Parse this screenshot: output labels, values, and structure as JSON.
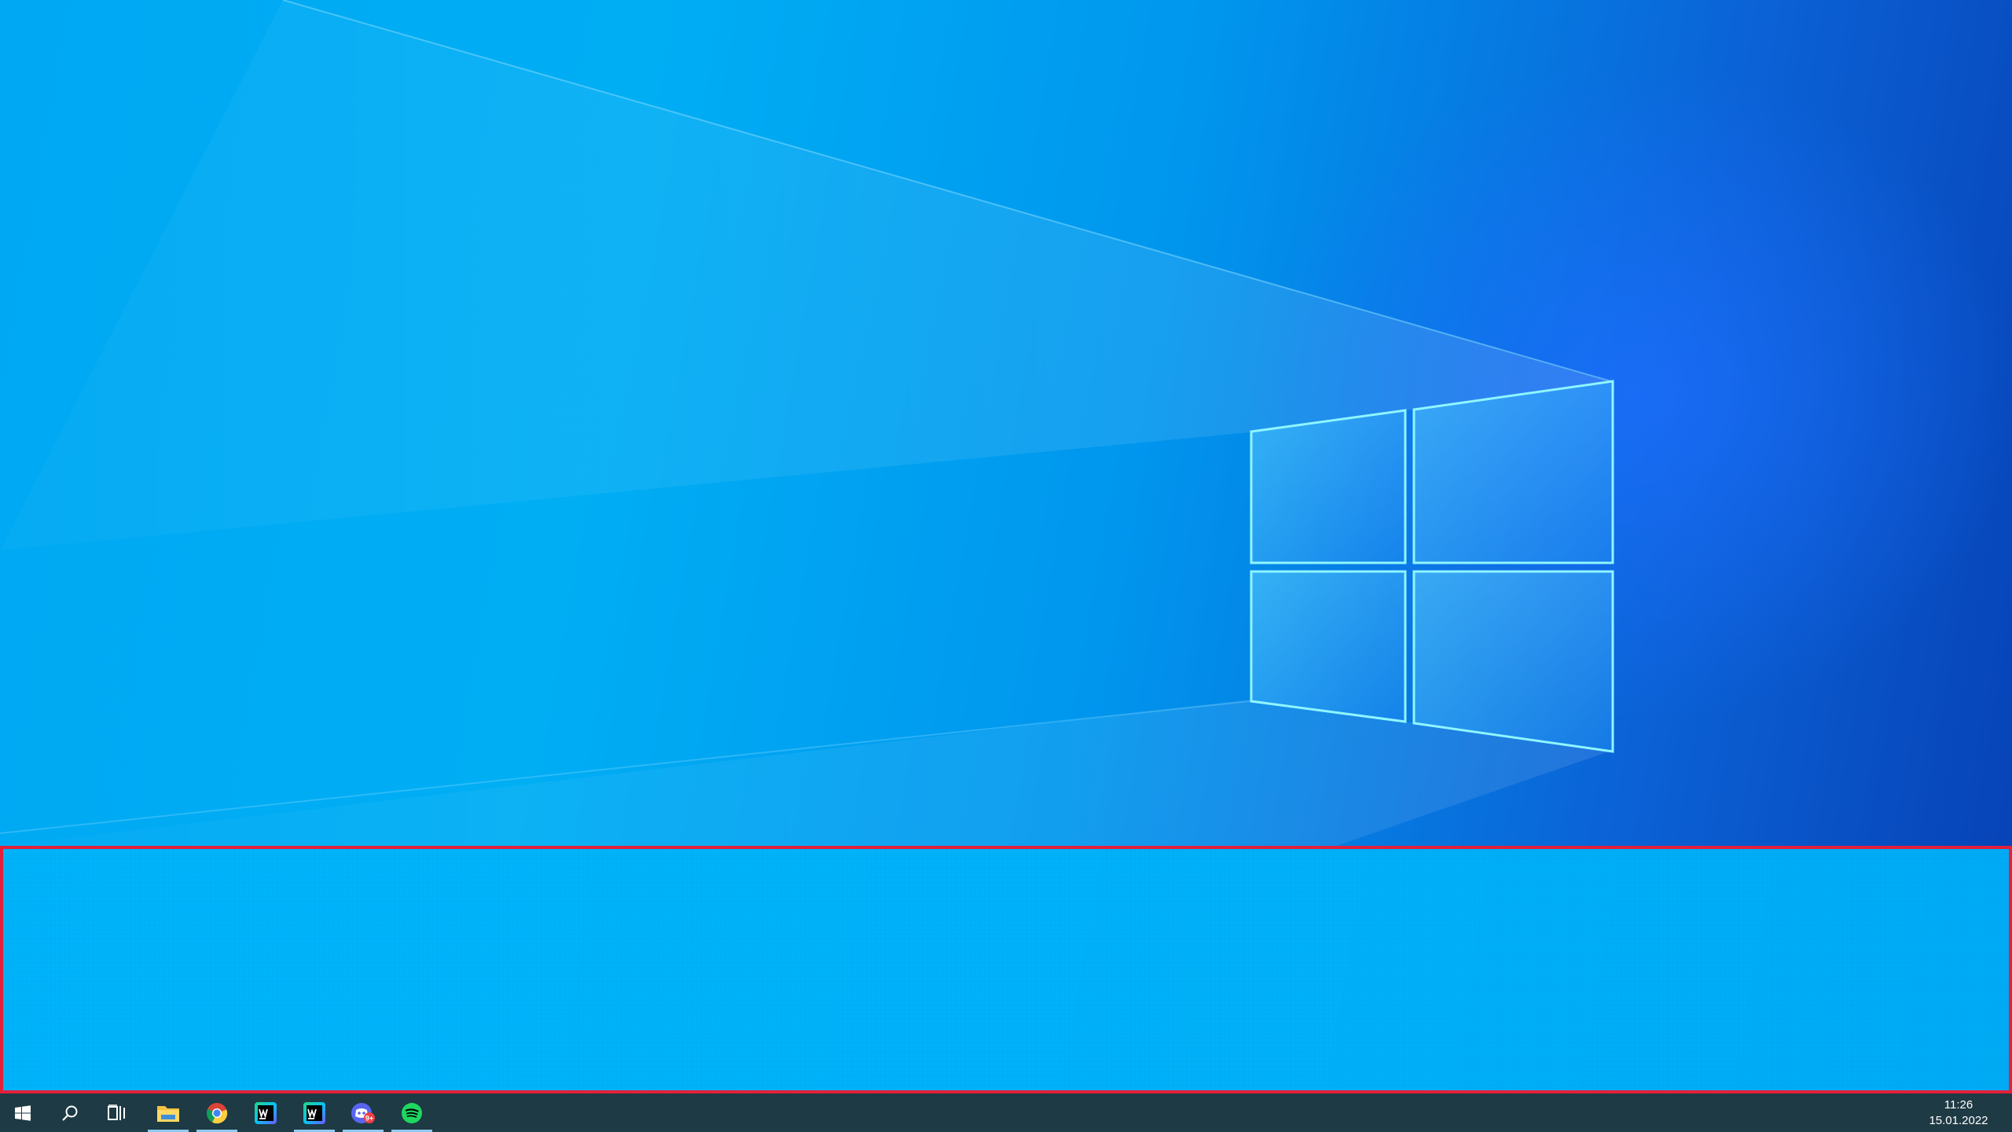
{
  "desktop": {
    "wallpaper": "windows-10-hero",
    "colors": {
      "light_blue": "#00aef4",
      "deep_blue": "#0640b4",
      "logo_glow": "#7ff3ff"
    }
  },
  "selection": {
    "border_color": "#e3203a"
  },
  "taskbar": {
    "background": "#1e3a44",
    "system_buttons": [
      {
        "name": "start-button",
        "icon": "windows-logo-icon"
      },
      {
        "name": "search-button",
        "icon": "search-icon"
      },
      {
        "name": "task-view-button",
        "icon": "task-view-icon"
      }
    ],
    "apps": [
      {
        "name": "file-explorer",
        "icon": "folder-icon",
        "running": true
      },
      {
        "name": "google-chrome",
        "icon": "chrome-icon",
        "running": true
      },
      {
        "name": "webstorm",
        "icon": "webstorm-icon",
        "running": false
      },
      {
        "name": "webstorm-2",
        "icon": "webstorm-icon",
        "running": true
      },
      {
        "name": "discord",
        "icon": "discord-icon",
        "running": true,
        "badge": "9+"
      },
      {
        "name": "spotify",
        "icon": "spotify-icon",
        "running": true
      }
    ],
    "clock": {
      "time": "11:26",
      "date": "15.01.2022"
    }
  }
}
